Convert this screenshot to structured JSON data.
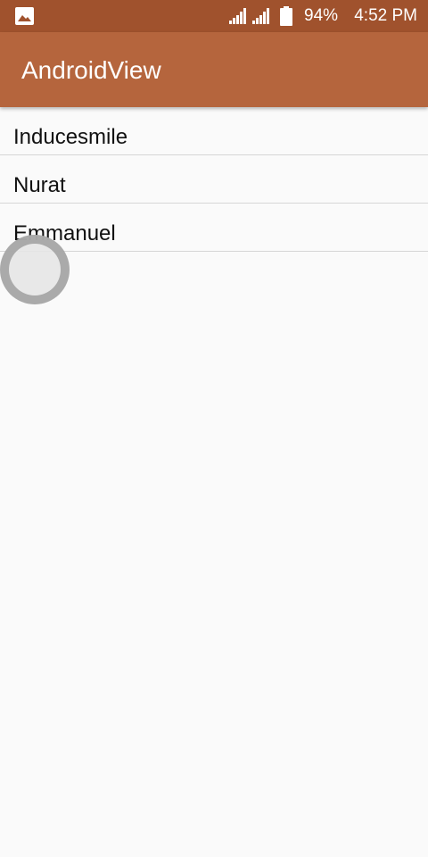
{
  "status_bar": {
    "battery_percent": "94%",
    "time": "4:52 PM",
    "icons": [
      "gallery-icon",
      "signal-icon",
      "signal-icon",
      "battery-icon"
    ]
  },
  "app_bar": {
    "title": "AndroidView"
  },
  "list": {
    "items": [
      {
        "label": "Inducesmile"
      },
      {
        "label": "Nurat"
      },
      {
        "label": "Emmanuel"
      }
    ]
  },
  "colors": {
    "status_bar": "#a0522d",
    "app_bar": "#b5653d",
    "background": "#fafafa",
    "divider": "#d6d6d6"
  }
}
